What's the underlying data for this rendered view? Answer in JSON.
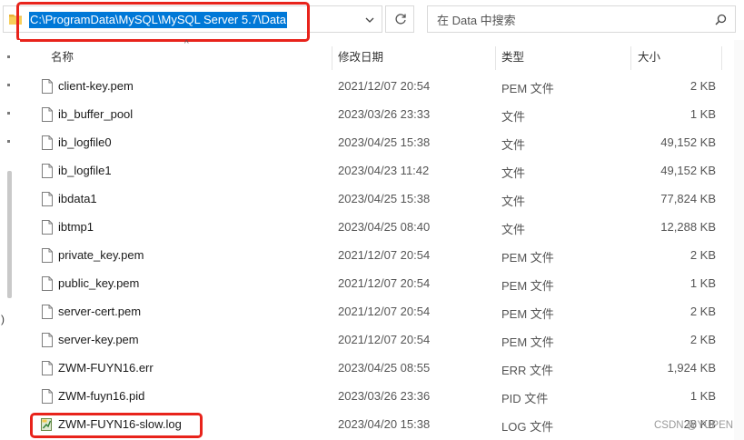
{
  "address": {
    "path": "C:\\ProgramData\\MySQL\\MySQL Server 5.7\\Data"
  },
  "search": {
    "placeholder": "在 Data 中搜索"
  },
  "columns": {
    "name": "名称",
    "date": "修改日期",
    "type": "类型",
    "size": "大小"
  },
  "files": [
    {
      "name": "client-key.pem",
      "date": "2021/12/07 20:54",
      "type": "PEM 文件",
      "size": "2 KB",
      "icon": "file-icon"
    },
    {
      "name": "ib_buffer_pool",
      "date": "2023/03/26 23:33",
      "type": "文件",
      "size": "1 KB",
      "icon": "file-icon"
    },
    {
      "name": "ib_logfile0",
      "date": "2023/04/25 15:38",
      "type": "文件",
      "size": "49,152 KB",
      "icon": "file-icon"
    },
    {
      "name": "ib_logfile1",
      "date": "2023/04/23 11:42",
      "type": "文件",
      "size": "49,152 KB",
      "icon": "file-icon"
    },
    {
      "name": "ibdata1",
      "date": "2023/04/25 15:38",
      "type": "文件",
      "size": "77,824 KB",
      "icon": "file-icon"
    },
    {
      "name": "ibtmp1",
      "date": "2023/04/25 08:40",
      "type": "文件",
      "size": "12,288 KB",
      "icon": "file-icon"
    },
    {
      "name": "private_key.pem",
      "date": "2021/12/07 20:54",
      "type": "PEM 文件",
      "size": "2 KB",
      "icon": "file-icon"
    },
    {
      "name": "public_key.pem",
      "date": "2021/12/07 20:54",
      "type": "PEM 文件",
      "size": "1 KB",
      "icon": "file-icon"
    },
    {
      "name": "server-cert.pem",
      "date": "2021/12/07 20:54",
      "type": "PEM 文件",
      "size": "2 KB",
      "icon": "file-icon"
    },
    {
      "name": "server-key.pem",
      "date": "2021/12/07 20:54",
      "type": "PEM 文件",
      "size": "2 KB",
      "icon": "file-icon"
    },
    {
      "name": "ZWM-FUYN16.err",
      "date": "2023/04/25 08:55",
      "type": "ERR 文件",
      "size": "1,924 KB",
      "icon": "file-icon"
    },
    {
      "name": "ZWM-fuyn16.pid",
      "date": "2023/03/26 23:36",
      "type": "PID 文件",
      "size": "1 KB",
      "icon": "file-icon"
    },
    {
      "name": "ZWM-FUYN16-slow.log",
      "date": "2023/04/20 15:38",
      "type": "LOG 文件",
      "size": "28 KB",
      "icon": "log-file-icon"
    }
  ],
  "left_pane": {
    "fragment": ")"
  },
  "watermark": "CSDN @YUPEN",
  "colors": {
    "selection": "#0078d7",
    "highlight_box": "#e8231b",
    "folder": "#e8b339"
  }
}
